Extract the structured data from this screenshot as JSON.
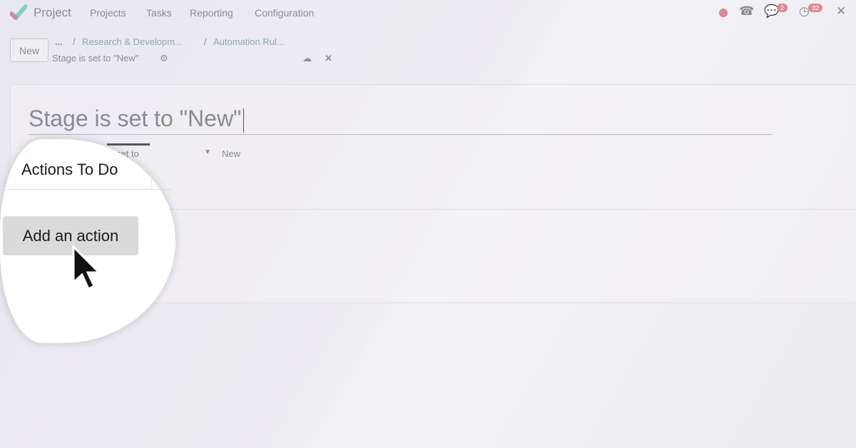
{
  "nav": {
    "app": "Project",
    "menu": [
      "Projects",
      "Tasks",
      "Reporting",
      "Configuration"
    ],
    "messages_badge": "2",
    "activities_badge": "32",
    "status_color": "#d98a9a"
  },
  "control": {
    "new_label": "New",
    "breadcrumb": [
      "...",
      "Research & Developm...",
      "Automation Rul..."
    ],
    "record": "Stage is set to \"New\""
  },
  "form": {
    "title": "Stage is set to \"New\"",
    "trigger_label": "is set to",
    "trigger_value": "New"
  },
  "magnifier": {
    "tab": "Actions To Do",
    "add_action": "Add an action"
  }
}
